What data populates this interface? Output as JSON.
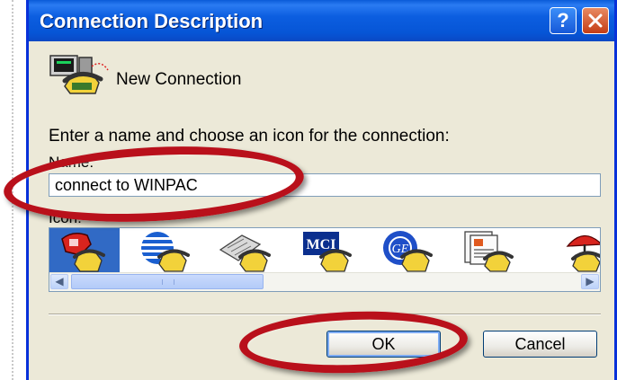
{
  "window": {
    "title": "Connection Description",
    "help_glyph": "?",
    "close_icon": "close-icon"
  },
  "header": {
    "icon": "new-connection-phone-icon",
    "label": "New Connection"
  },
  "form": {
    "prompt": "Enter a name and choose an icon for the connection:",
    "name_label": "Name:",
    "name_value": "connect to WINPAC",
    "icon_label": "Icon:",
    "icons": [
      {
        "name": "red-phone-icon",
        "selected": true
      },
      {
        "name": "globe-stripes-phone-icon",
        "selected": false
      },
      {
        "name": "fax-phone-icon",
        "selected": false
      },
      {
        "name": "mci-phone-icon",
        "selected": false,
        "text": "MCI"
      },
      {
        "name": "ge-globe-phone-icon",
        "selected": false,
        "text": "GE"
      },
      {
        "name": "document-phone-icon",
        "selected": false
      },
      {
        "name": "umbrella-phone-icon",
        "selected": false
      }
    ]
  },
  "buttons": {
    "ok": "OK",
    "cancel": "Cancel"
  },
  "colors": {
    "titlebar": "#0a5bd8",
    "dialog_bg": "#ece9d8",
    "selection": "#316ac5",
    "annotation": "#b9101b"
  }
}
